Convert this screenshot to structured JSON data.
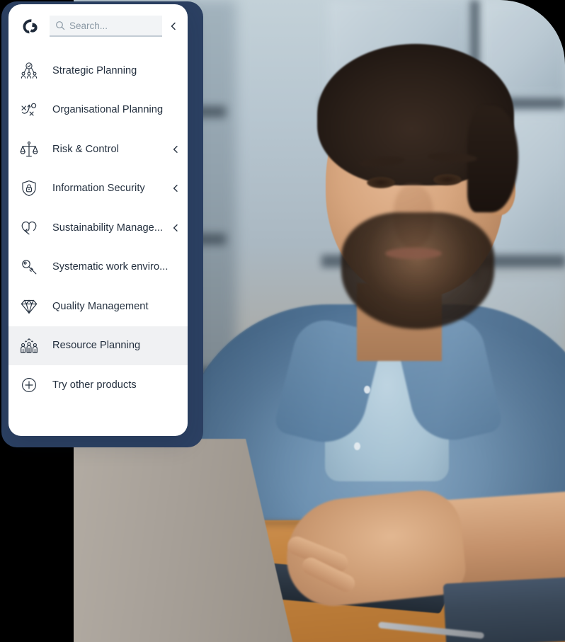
{
  "brand": {
    "logo_icon": "grc-swirl-logo-icon"
  },
  "search": {
    "placeholder": "Search...",
    "value": "",
    "icon": "search-icon"
  },
  "header": {
    "collapse_icon": "chevron-left-icon"
  },
  "sidebar": {
    "items": [
      {
        "label": "Strategic Planning",
        "icon": "team-check-icon",
        "has_chevron": false,
        "active": false
      },
      {
        "label": "Organisational Planning",
        "icon": "strategy-board-icon",
        "has_chevron": false,
        "active": false
      },
      {
        "label": "Risk & Control",
        "icon": "scales-balance-icon",
        "has_chevron": true,
        "active": false
      },
      {
        "label": "Information Security",
        "icon": "shield-lock-icon",
        "has_chevron": true,
        "active": false
      },
      {
        "label": "Sustainability Manage...",
        "icon": "heart-arrow-icon",
        "has_chevron": true,
        "active": false
      },
      {
        "label": "Systematic work enviro...",
        "icon": "key-icon",
        "has_chevron": false,
        "active": false
      },
      {
        "label": "Quality Management",
        "icon": "diamond-icon",
        "has_chevron": false,
        "active": false
      },
      {
        "label": "Resource Planning",
        "icon": "people-group-icon",
        "has_chevron": false,
        "active": true
      },
      {
        "label": "Try other products",
        "icon": "plus-circle-icon",
        "has_chevron": false,
        "active": false
      }
    ]
  },
  "colors": {
    "accent_teal": "#10a0b0",
    "navy_backdrop": "#2c4163",
    "text_primary": "#24303f",
    "active_row_bg": "#f0f1f3",
    "search_bg": "#f2f4f6"
  },
  "photo": {
    "alt": "Man in denim shirt typing on a laptop at a wooden desk in a bright office"
  }
}
